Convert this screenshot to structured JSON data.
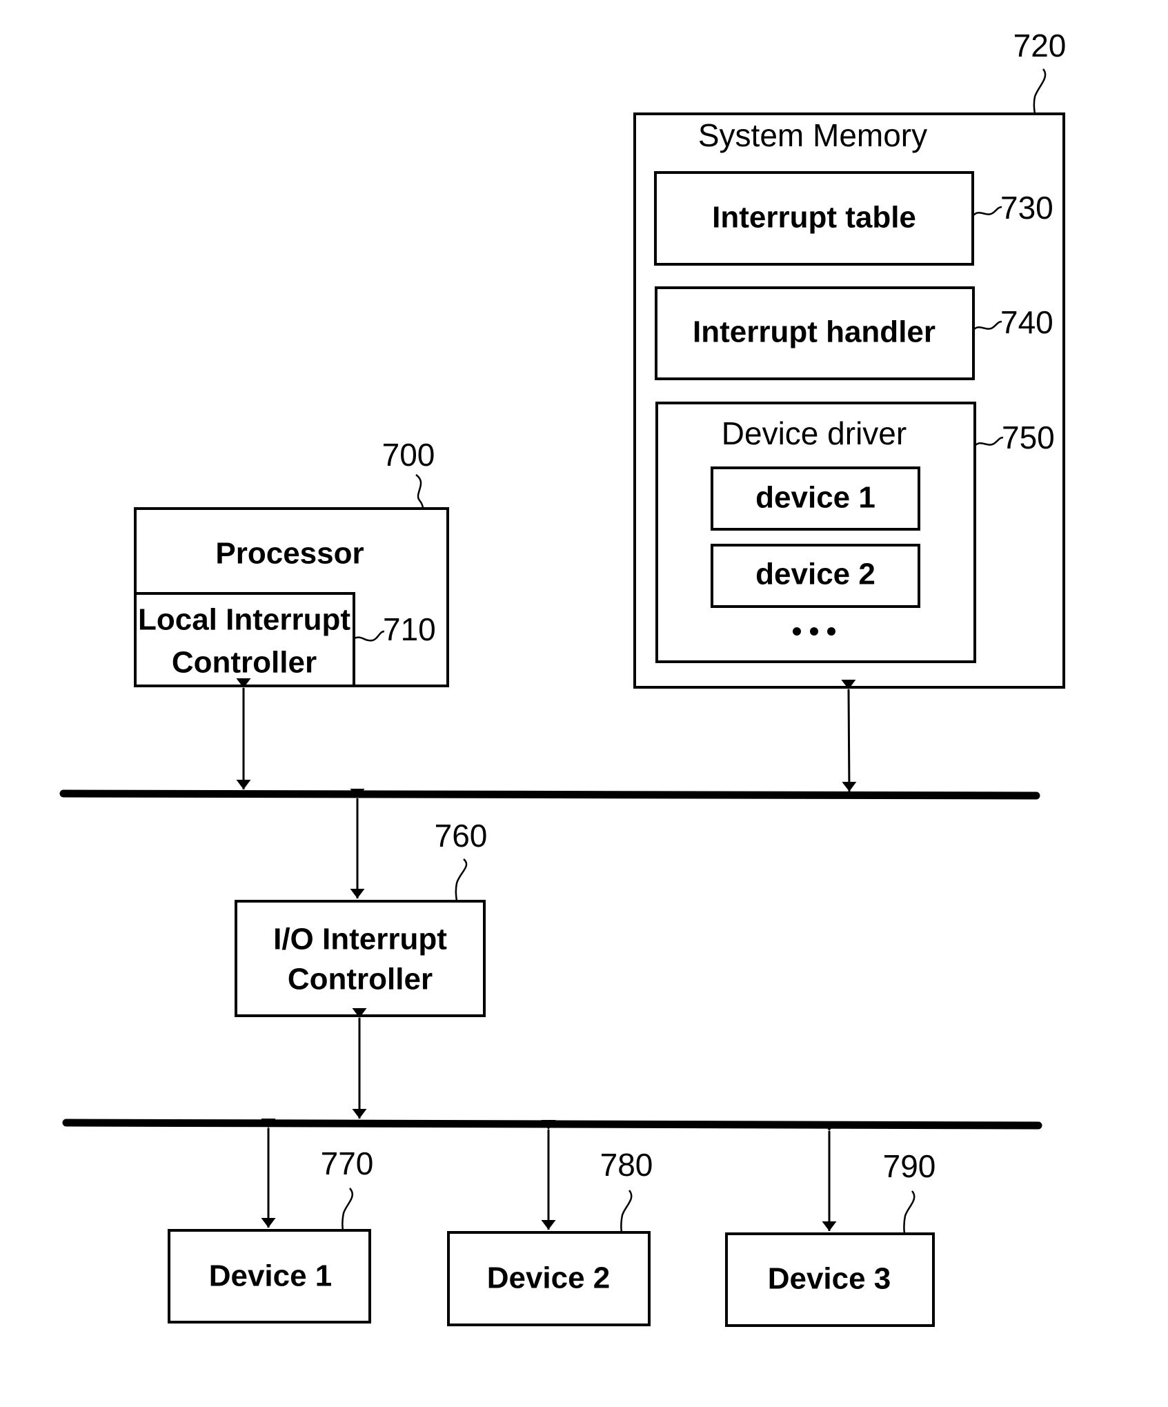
{
  "figure": {
    "components": {
      "processor": {
        "label": "Processor",
        "ref": "700"
      },
      "local_interrupt_controller": {
        "label_line1": "Local Interrupt",
        "label_line2": "Controller",
        "ref": "710"
      },
      "system_memory": {
        "label": "System Memory",
        "ref": "720"
      },
      "interrupt_table": {
        "label": "Interrupt table",
        "ref": "730"
      },
      "interrupt_handler": {
        "label": "Interrupt handler",
        "ref": "740"
      },
      "device_driver": {
        "label": "Device driver",
        "ref": "750",
        "entries": [
          "device 1",
          "device 2"
        ],
        "ellipsis": "• • •"
      },
      "io_interrupt_controller": {
        "label_line1": "I/O Interrupt",
        "label_line2": "Controller",
        "ref": "760"
      },
      "devices": [
        {
          "label": "Device 1",
          "ref": "770"
        },
        {
          "label": "Device 2",
          "ref": "780"
        },
        {
          "label": "Device 3",
          "ref": "790"
        }
      ]
    },
    "connections": [
      {
        "from": "local_interrupt_controller",
        "to": "system_bus",
        "type": "bidirectional"
      },
      {
        "from": "system_memory",
        "to": "system_bus",
        "type": "bidirectional"
      },
      {
        "from": "system_bus",
        "to": "io_interrupt_controller",
        "type": "bidirectional"
      },
      {
        "from": "io_interrupt_controller",
        "to": "io_bus",
        "type": "bidirectional"
      },
      {
        "from": "io_bus",
        "to": "device_1",
        "type": "bidirectional"
      },
      {
        "from": "io_bus",
        "to": "device_2",
        "type": "bidirectional"
      },
      {
        "from": "io_bus",
        "to": "device_3",
        "type": "bidirectional"
      }
    ]
  }
}
